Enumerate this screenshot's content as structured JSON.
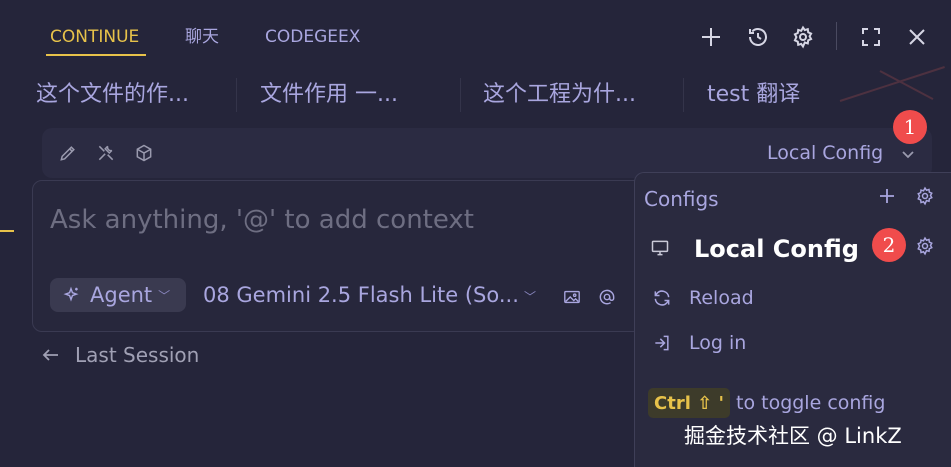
{
  "tabs": [
    {
      "label": "CONTINUE",
      "active": true
    },
    {
      "label": "聊天",
      "active": false
    },
    {
      "label": "CODEGEEX",
      "active": false
    }
  ],
  "top_icons": [
    "plus-icon",
    "history-icon",
    "gear-icon",
    "fullscreen-icon",
    "close-icon"
  ],
  "history": [
    "这个文件的作...",
    "文件作用 一...",
    "这个工程为什...",
    "test 翻译"
  ],
  "toolbar": {
    "icons": [
      "pencil-icon",
      "tools-icon",
      "cube-icon"
    ],
    "config_label": "Local Config"
  },
  "input": {
    "placeholder": "Ask anything, '@' to add context",
    "mode_label": "Agent",
    "model_label": "08 Gemini 2.5 Flash Lite (So..."
  },
  "last_session": "Last Session",
  "config_panel": {
    "header": "Configs",
    "current": "Local Config",
    "items": [
      "Reload",
      "Log in"
    ],
    "shortcut": "Ctrl ⇧ '",
    "shortcut_text": "to toggle config"
  },
  "markers": [
    "1",
    "2"
  ],
  "watermark": "掘金技术社区 @ LinkZ",
  "colors": {
    "background": "#25253a",
    "accent": "#e7c24a",
    "text": "#a9a6df",
    "marker": "#f04c4c"
  }
}
